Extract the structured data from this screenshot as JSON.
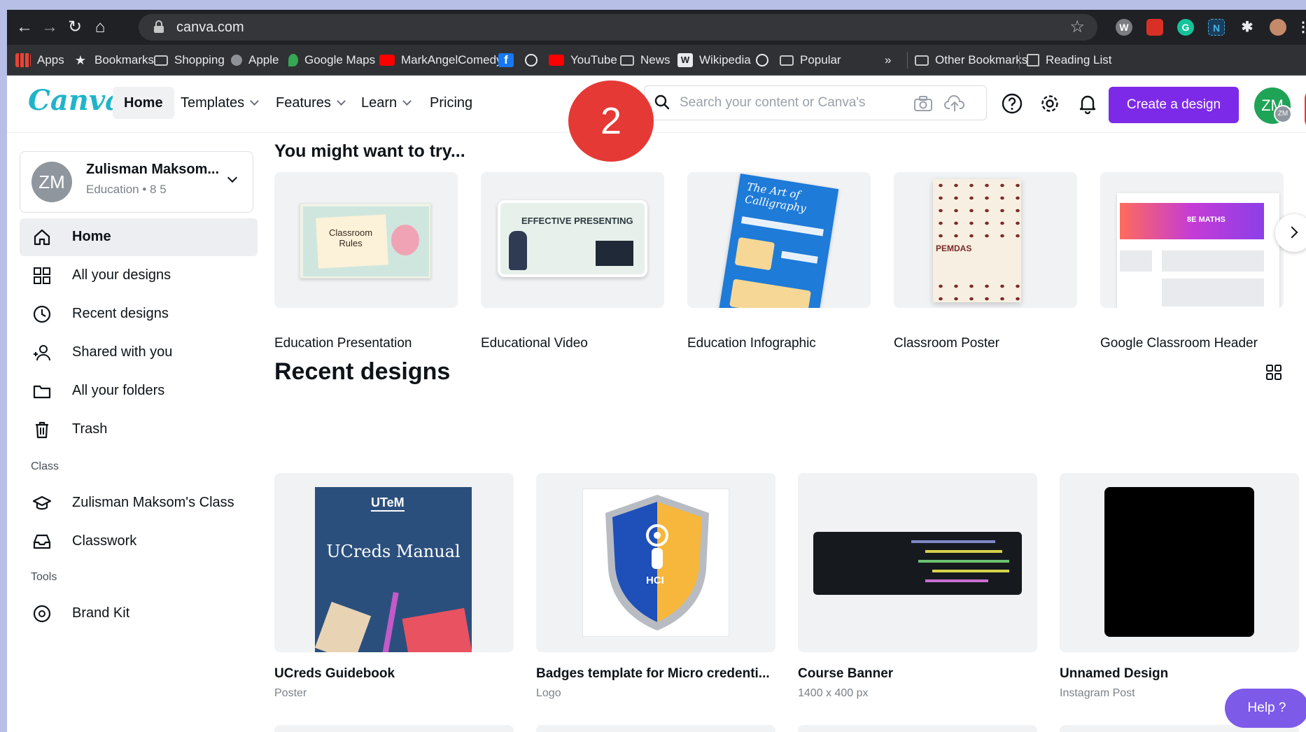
{
  "browser": {
    "url": "canva.com",
    "bookmarks": [
      "Apps",
      "Bookmarks",
      "Shopping",
      "Apple",
      "Google Maps",
      "MarkAngelComedy",
      "YouTube",
      "News",
      "Wikipedia",
      "Popular"
    ],
    "overflow": "»",
    "other_bookmarks": "Other Bookmarks",
    "reading_list": "Reading List"
  },
  "header": {
    "logo": "Canva",
    "nav": [
      "Home",
      "Templates",
      "Features",
      "Learn",
      "Pricing"
    ],
    "search_placeholder": "Search your content or Canva's",
    "create_label": "Create a design",
    "avatar_initials": "ZM",
    "avatar_badge": "ZM"
  },
  "annotation": {
    "step": "2"
  },
  "sidebar": {
    "team_initials": "ZM",
    "team_name": "Zulisman Maksom...",
    "team_sub": "Education • 8 5",
    "items": [
      "Home",
      "All your designs",
      "Recent designs",
      "Shared with you",
      "All your folders",
      "Trash"
    ],
    "class_heading": "Class",
    "class_items": [
      "Zulisman Maksom's Class",
      "Classwork"
    ],
    "tools_heading": "Tools",
    "tools_items": [
      "Brand Kit"
    ]
  },
  "main": {
    "try_heading": "You might want to try...",
    "try_items": [
      "Education Presentation",
      "Educational Video",
      "Education Infographic",
      "Classroom Poster",
      "Google Classroom Header"
    ],
    "recent_heading": "Recent designs",
    "recent": [
      {
        "title": "UCreds Guidebook",
        "sub": "Poster"
      },
      {
        "title": "Badges template for Micro credenti...",
        "sub": "Logo"
      },
      {
        "title": "Course Banner",
        "sub": "1400 x 400 px"
      },
      {
        "title": "Unnamed Design",
        "sub": "Instagram Post"
      }
    ],
    "thumb_text": {
      "classroom": "Classroom Rules",
      "presenting": "EFFECTIVE PRESENTING",
      "calligraphy": "The Art of Calligraphy",
      "pemdas": "PEMDAS",
      "maths": "8E MATHS",
      "utem": "UTeM",
      "manual": "UCreds Manual",
      "hci": "HCI"
    }
  },
  "help_label": "Help ?"
}
